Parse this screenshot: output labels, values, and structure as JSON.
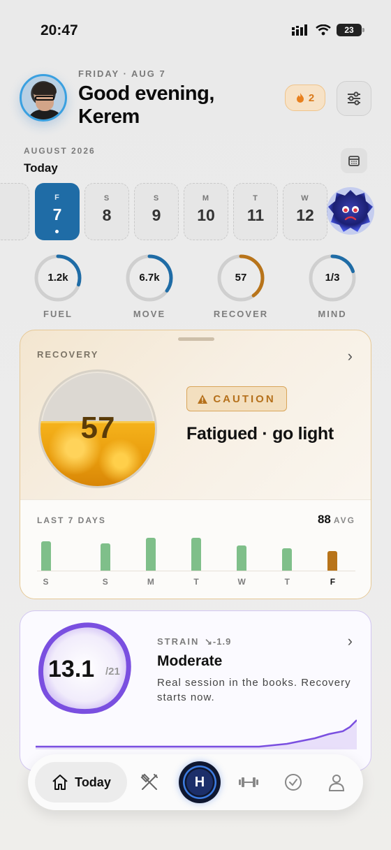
{
  "status": {
    "time": "20:47",
    "battery": "23"
  },
  "header": {
    "date": "FRIDAY · AUG 7",
    "greeting": "Good evening,",
    "name": "Kerem",
    "streak": "2"
  },
  "calendar": {
    "month": "AUGUST 2026",
    "today_label": "Today",
    "days": [
      {
        "dow": "F",
        "num": "7",
        "active": true
      },
      {
        "dow": "S",
        "num": "8"
      },
      {
        "dow": "S",
        "num": "9"
      },
      {
        "dow": "M",
        "num": "10"
      },
      {
        "dow": "T",
        "num": "11"
      },
      {
        "dow": "W",
        "num": "12"
      }
    ]
  },
  "rings": [
    {
      "value": "1.2k",
      "label": "FUEL",
      "progress": 0.3,
      "color": "#1f6ca6"
    },
    {
      "value": "6.7k",
      "label": "MOVE",
      "progress": 0.35,
      "color": "#1f6ca6"
    },
    {
      "value": "57",
      "label": "RECOVER",
      "progress": 0.4,
      "color": "#b8741a"
    },
    {
      "value": "1/3",
      "label": "MIND",
      "progress": 0.2,
      "color": "#1f6ca6"
    }
  ],
  "recovery": {
    "label": "RECOVERY",
    "score": "57",
    "badge": "CAUTION",
    "status": "Fatigued · go light",
    "history_label": "LAST 7 DAYS",
    "avg_value": "88",
    "avg_label": "AVG",
    "days": [
      "S",
      "S",
      "M",
      "T",
      "W",
      "T",
      "F"
    ],
    "values": [
      92,
      90,
      96,
      96,
      88,
      85,
      57
    ],
    "colors": {
      "good": "#7fbf8a",
      "today": "#b8741a",
      "accent": "#d9791a"
    }
  },
  "strain": {
    "value": "13.1",
    "max": "/21",
    "label": "STRAIN",
    "delta": "-1.9",
    "title": "Moderate",
    "description": "Real session in the books. Recovery starts now.",
    "color": "#7a4fe0"
  },
  "tabbar": {
    "today": "Today",
    "center": "H",
    "icons": [
      "home-icon",
      "fork-knife-icon",
      "dumbbell-icon",
      "check-circle-icon",
      "person-icon"
    ]
  }
}
